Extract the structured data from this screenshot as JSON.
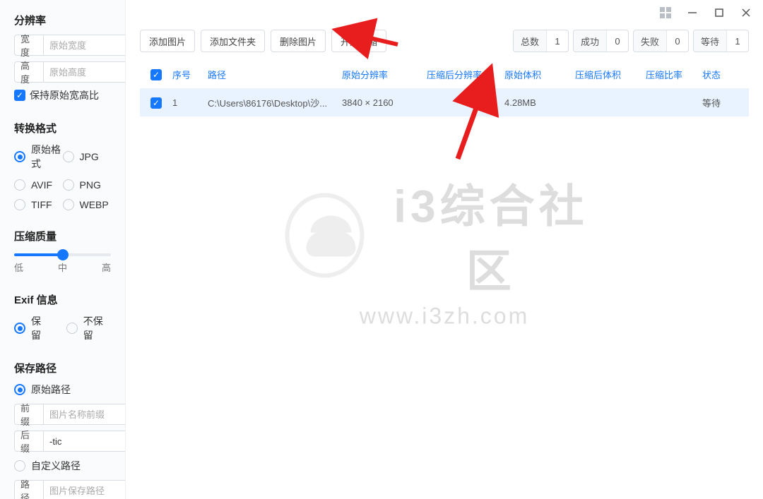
{
  "sidebar": {
    "resolution": {
      "title": "分辨率",
      "width_label": "宽度",
      "width_placeholder": "原始宽度",
      "height_label": "高度",
      "height_placeholder": "原始高度",
      "keep_ratio_label": "保持原始宽高比",
      "keep_ratio_checked": true
    },
    "format": {
      "title": "转换格式",
      "options": [
        "原始格式",
        "JPG",
        "AVIF",
        "PNG",
        "TIFF",
        "WEBP"
      ],
      "selected": "原始格式"
    },
    "quality": {
      "title": "压缩质量",
      "low": "低",
      "mid": "中",
      "high": "高",
      "value_percent": 50
    },
    "exif": {
      "title": "Exif 信息",
      "keep": "保留",
      "discard": "不保留",
      "selected": "保留"
    },
    "save": {
      "title": "保存路径",
      "original_path": "原始路径",
      "prefix_label": "前缀",
      "prefix_placeholder": "图片名称前缀",
      "suffix_label": "后缀",
      "suffix_value": "-tic",
      "custom_path": "自定义路径",
      "path_label": "路径",
      "path_placeholder": "图片保存路径",
      "selected": "原始路径"
    }
  },
  "toolbar": {
    "add_image": "添加图片",
    "add_folder": "添加文件夹",
    "delete_image": "删除图片",
    "start_compress": "开始压缩"
  },
  "stats": {
    "total_label": "总数",
    "total_value": "1",
    "success_label": "成功",
    "success_value": "0",
    "fail_label": "失败",
    "fail_value": "0",
    "wait_label": "等待",
    "wait_value": "1"
  },
  "table": {
    "headers": {
      "index": "序号",
      "path": "路径",
      "orig_res": "原始分辨率",
      "comp_res": "压缩后分辨率",
      "orig_size": "原始体积",
      "comp_size": "压缩后体积",
      "ratio": "压缩比率",
      "status": "状态"
    },
    "rows": [
      {
        "checked": true,
        "index": "1",
        "path": "C:\\Users\\86176\\Desktop\\沙...",
        "orig_res": "3840 × 2160",
        "comp_res": "",
        "orig_size": "4.28MB",
        "comp_size": "",
        "ratio": "",
        "status": "等待"
      }
    ]
  },
  "watermark": {
    "title": "i3综合社区",
    "sub": "www.i3zh.com"
  }
}
